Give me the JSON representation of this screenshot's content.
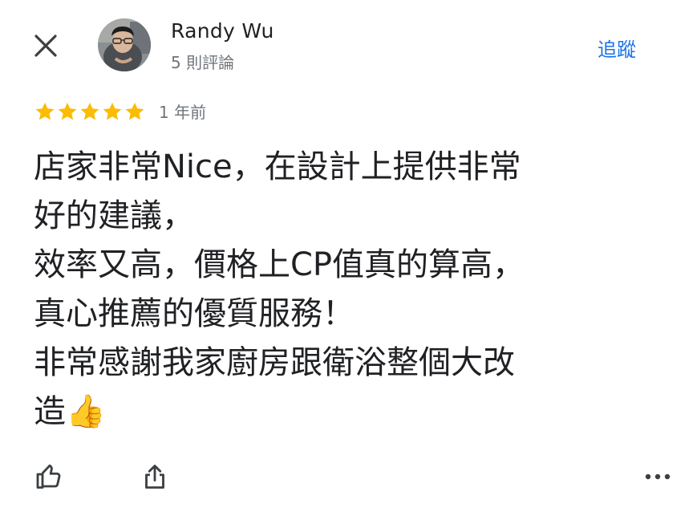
{
  "header": {
    "user_name": "Randy Wu",
    "review_count": "5 則評論",
    "follow_label": "追蹤"
  },
  "review": {
    "rating": 5,
    "max_rating": 5,
    "time_ago": "1 年前",
    "lines": [
      "店家非常Nice，在設計上提供非常",
      "好的建議，",
      "效率又高，價格上CP值真的算高，",
      "真心推薦的優質服務！",
      "非常感謝我家廚房跟衛浴整個大改",
      "造👍"
    ]
  },
  "colors": {
    "star": "#fbbc04",
    "accent": "#1a73e8",
    "text_primary": "#202124",
    "text_secondary": "#70757a"
  },
  "icons": {
    "close": "close-icon",
    "like": "thumbs-up-icon",
    "share": "share-icon",
    "more": "more-horiz-icon"
  }
}
